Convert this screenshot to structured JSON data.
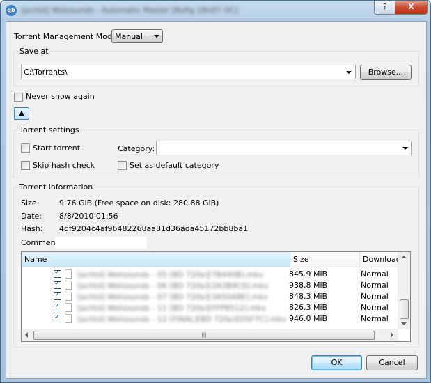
{
  "window": {
    "title": "[pchtd] Wotsounds - Automatic Master [Rufig 18n07 OC]"
  },
  "titlebar": {
    "help_label": "?",
    "close_label": "X"
  },
  "mode": {
    "label": "Torrent Management Mode:",
    "value": "Manual"
  },
  "save_at": {
    "title": "Save at",
    "path": "C:\\Torrents\\",
    "browse_label": "Browse..."
  },
  "never_show_label": "Never show again",
  "collapse_label": "▲",
  "torrent_settings": {
    "title": "Torrent settings",
    "start_torrent": "Start torrent",
    "skip_hash": "Skip hash check",
    "category_label": "Category:",
    "category_value": "",
    "set_default": "Set as default category"
  },
  "info": {
    "title": "Torrent information",
    "size_label": "Size:",
    "size_value": "9.76 GiB (Free space on disk: 280.88 GiB)",
    "date_label": "Date:",
    "date_value": "8/8/2010 01:56",
    "hash_label": "Hash:",
    "hash_value": "4df9204c4af96482268aa81d36ada45172bb8ba1",
    "comment_label": "Comment:",
    "comment_value": ""
  },
  "files": {
    "columns": [
      "Name",
      "Size",
      "Download P"
    ],
    "rows": [
      {
        "name": "[pchtd] Wotsounds - 05 [BD 720p][7B440B].mkv",
        "size": "845.9 MiB",
        "priority": "Normal"
      },
      {
        "name": "[pchtd] Wotsounds - 06 [BD 720p][2A3B9C0].mkv",
        "size": "938.8 MiB",
        "priority": "Normal"
      },
      {
        "name": "[pchtd] Wotsounds - 07 [BD 720p][3A50A8E].mkv",
        "size": "848.3 MiB",
        "priority": "Normal"
      },
      {
        "name": "[pchtd] Wotsounds - 11 [BD 720p][FFP8512].mkv",
        "size": "826.3 MiB",
        "priority": "Normal"
      },
      {
        "name": "[pchtd] Wotsounds - 12 [FINAL][BD 720p][D5F7C].mkv",
        "size": "946.0 MiB",
        "priority": "Normal"
      }
    ]
  },
  "buttons": {
    "ok": "OK",
    "cancel": "Cancel"
  }
}
